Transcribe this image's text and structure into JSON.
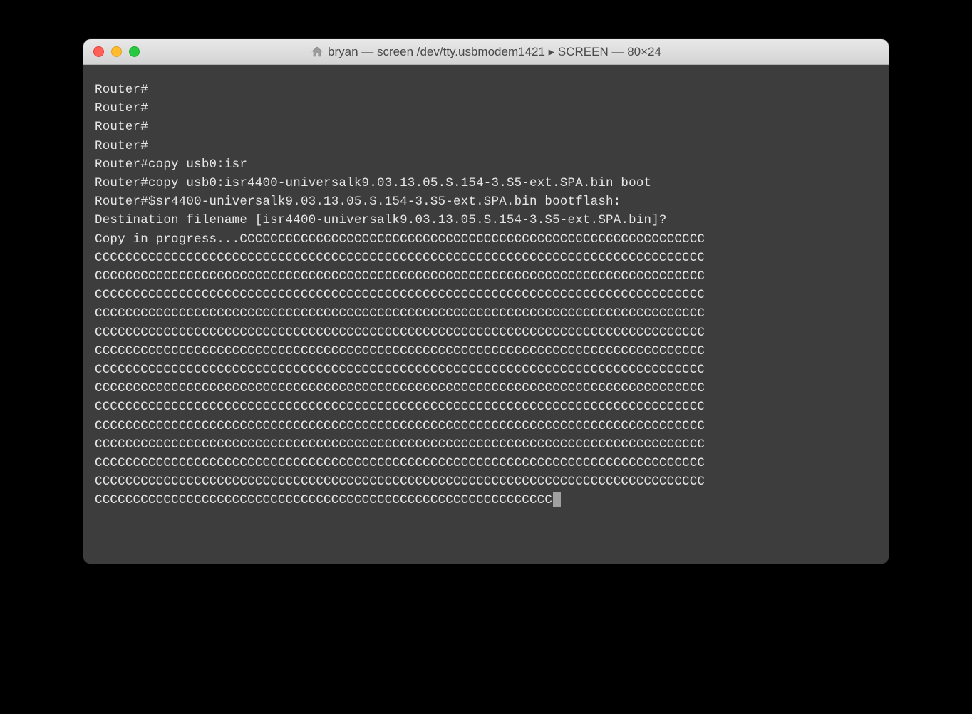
{
  "window": {
    "title": "bryan — screen /dev/tty.usbmodem1421 ▸ SCREEN — 80×24",
    "traffic_lights": {
      "close_color": "#ff5f57",
      "minimize_color": "#febc2e",
      "zoom_color": "#28c840"
    }
  },
  "terminal": {
    "lines": [
      "Router#",
      "Router#",
      "Router#",
      "Router#",
      "Router#copy usb0:isr",
      "Router#copy usb0:isr4400-universalk9.03.13.05.S.154-3.S5-ext.SPA.bin boot",
      "Router#$sr4400-universalk9.03.13.05.S.154-3.S5-ext.SPA.bin bootflash:",
      "Destination filename [isr4400-universalk9.03.13.05.S.154-3.S5-ext.SPA.bin]?",
      "Copy in progress...CCCCCCCCCCCCCCCCCCCCCCCCCCCCCCCCCCCCCCCCCCCCCCCCCCCCCCCCCCCCC",
      "CCCCCCCCCCCCCCCCCCCCCCCCCCCCCCCCCCCCCCCCCCCCCCCCCCCCCCCCCCCCCCCCCCCCCCCCCCCCCCCC",
      "CCCCCCCCCCCCCCCCCCCCCCCCCCCCCCCCCCCCCCCCCCCCCCCCCCCCCCCCCCCCCCCCCCCCCCCCCCCCCCCC",
      "CCCCCCCCCCCCCCCCCCCCCCCCCCCCCCCCCCCCCCCCCCCCCCCCCCCCCCCCCCCCCCCCCCCCCCCCCCCCCCCC",
      "CCCCCCCCCCCCCCCCCCCCCCCCCCCCCCCCCCCCCCCCCCCCCCCCCCCCCCCCCCCCCCCCCCCCCCCCCCCCCCCC",
      "CCCCCCCCCCCCCCCCCCCCCCCCCCCCCCCCCCCCCCCCCCCCCCCCCCCCCCCCCCCCCCCCCCCCCCCCCCCCCCCC",
      "CCCCCCCCCCCCCCCCCCCCCCCCCCCCCCCCCCCCCCCCCCCCCCCCCCCCCCCCCCCCCCCCCCCCCCCCCCCCCCCC",
      "CCCCCCCCCCCCCCCCCCCCCCCCCCCCCCCCCCCCCCCCCCCCCCCCCCCCCCCCCCCCCCCCCCCCCCCCCCCCCCCC",
      "CCCCCCCCCCCCCCCCCCCCCCCCCCCCCCCCCCCCCCCCCCCCCCCCCCCCCCCCCCCCCCCCCCCCCCCCCCCCCCCC",
      "CCCCCCCCCCCCCCCCCCCCCCCCCCCCCCCCCCCCCCCCCCCCCCCCCCCCCCCCCCCCCCCCCCCCCCCCCCCCCCCC",
      "CCCCCCCCCCCCCCCCCCCCCCCCCCCCCCCCCCCCCCCCCCCCCCCCCCCCCCCCCCCCCCCCCCCCCCCCCCCCCCCC",
      "CCCCCCCCCCCCCCCCCCCCCCCCCCCCCCCCCCCCCCCCCCCCCCCCCCCCCCCCCCCCCCCCCCCCCCCCCCCCCCCC",
      "CCCCCCCCCCCCCCCCCCCCCCCCCCCCCCCCCCCCCCCCCCCCCCCCCCCCCCCCCCCCCCCCCCCCCCCCCCCCCCCC",
      "CCCCCCCCCCCCCCCCCCCCCCCCCCCCCCCCCCCCCCCCCCCCCCCCCCCCCCCCCCCCCCCCCCCCCCCCCCCCCCCC",
      "CCCCCCCCCCCCCCCCCCCCCCCCCCCCCCCCCCCCCCCCCCCCCCCCCCCCCCCCCCCC"
    ]
  }
}
